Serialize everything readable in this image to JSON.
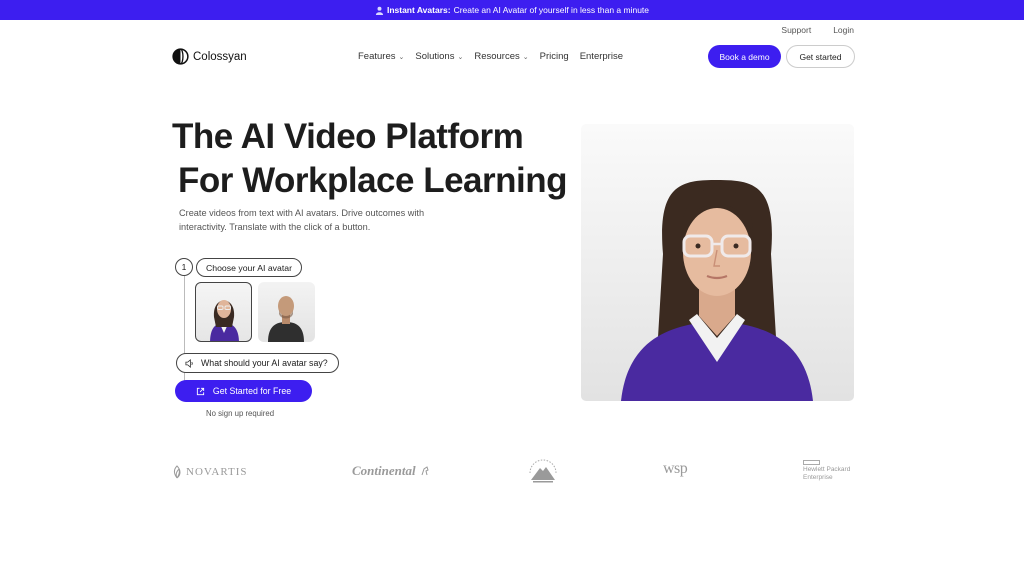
{
  "announcement": {
    "icon": "person-icon",
    "bold": "Instant Avatars:",
    "text": "Create an AI Avatar of yourself in less than a minute",
    "bg_color": "#3d1ef0"
  },
  "header": {
    "support": "Support",
    "login": "Login",
    "logo_text": "Colossyan",
    "nav": [
      {
        "label": "Features",
        "has_dropdown": true
      },
      {
        "label": "Solutions",
        "has_dropdown": true
      },
      {
        "label": "Resources",
        "has_dropdown": true
      },
      {
        "label": "Pricing",
        "has_dropdown": false
      },
      {
        "label": "Enterprise",
        "has_dropdown": false
      }
    ],
    "book_demo": "Book a demo",
    "get_started": "Get started"
  },
  "hero": {
    "title_line1": "The AI Video Platform",
    "title_line2": "For Workplace Learning",
    "subtitle": "Create videos from text with AI avatars. Drive outcomes with interactivity. Translate with the click of a button.",
    "step_number": "1",
    "step_label": "Choose your AI avatar",
    "say_prompt": "What should your AI avatar say?",
    "cta": "Get Started for Free",
    "no_signup": "No sign up required"
  },
  "logos": {
    "novartis": "NOVARTIS",
    "continental": "Continental",
    "wsp": "wsp",
    "hpe_line1": "Hewlett Packard",
    "hpe_line2": "Enterprise"
  },
  "colors": {
    "accent": "#3d1ef0",
    "sweater": "#4a2aa0"
  }
}
